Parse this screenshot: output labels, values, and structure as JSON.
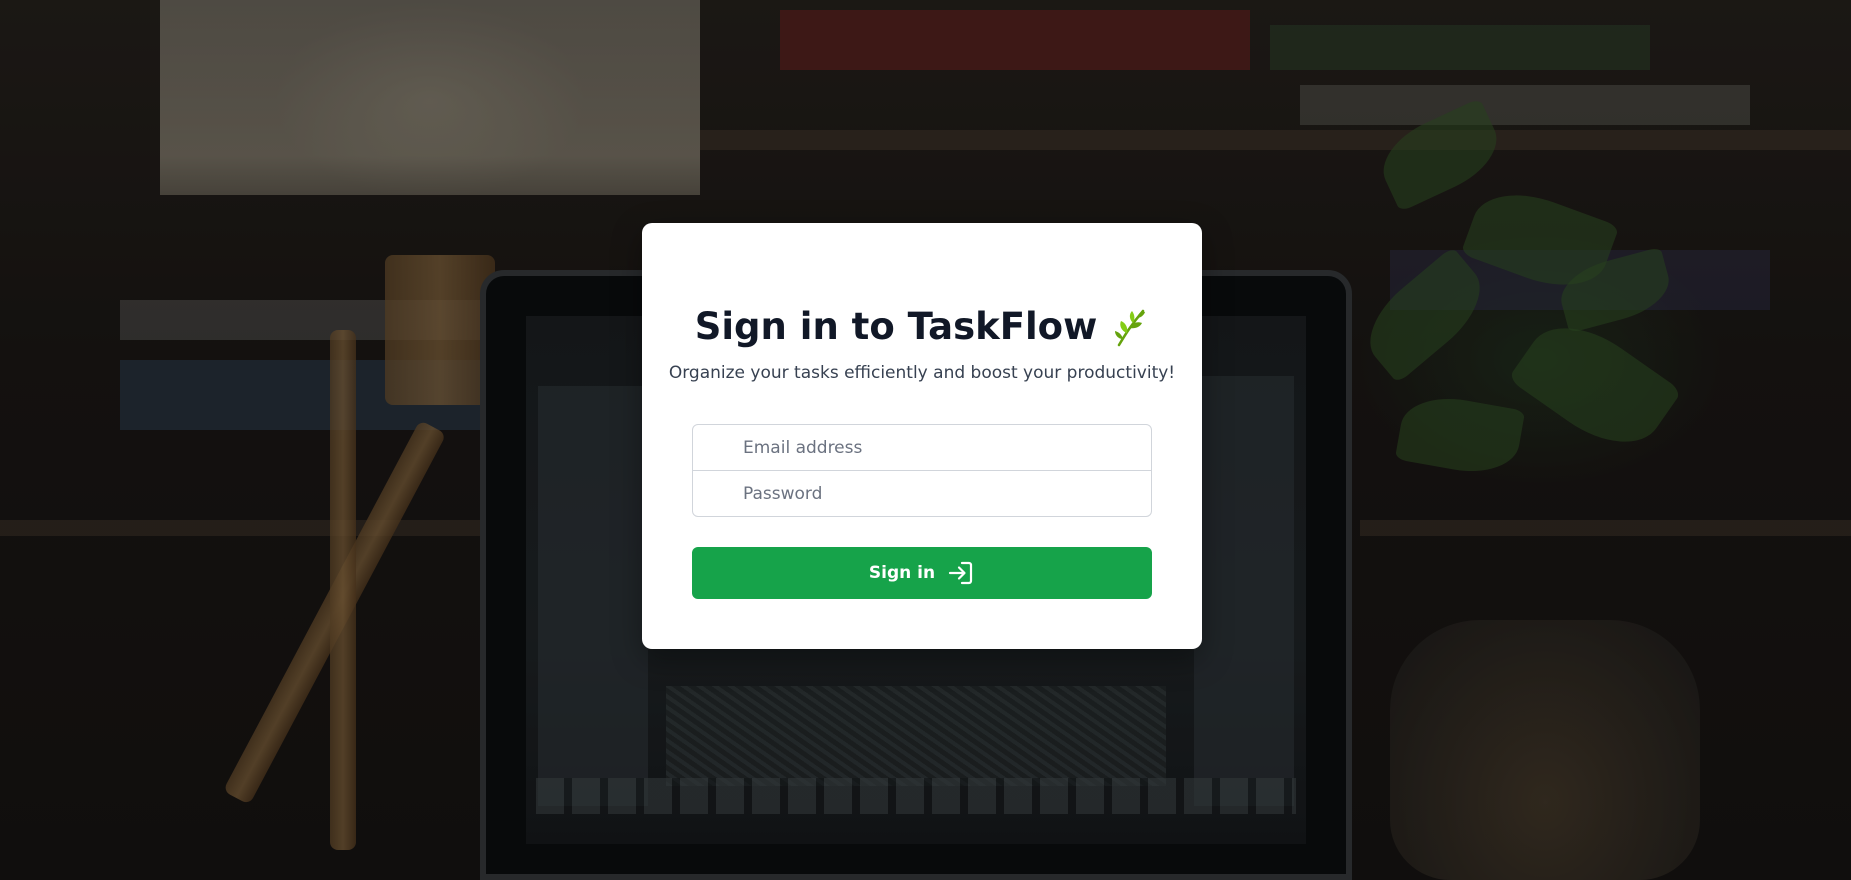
{
  "background": {
    "description_icon": "desk-workspace-photo",
    "laptop_app_icon": "photo-editor-screen"
  },
  "login": {
    "title": "Sign in to TaskFlow",
    "title_icon": "leaf-icon",
    "subtitle": "Organize your tasks efficiently and boost your productivity!",
    "email_placeholder": "Email address",
    "email_value": "",
    "password_placeholder": "Password",
    "password_value": "",
    "submit_label": "Sign in",
    "submit_icon": "sign-in-arrow-icon"
  },
  "colors": {
    "accent": "#16a34a",
    "title": "#111827",
    "subtitle": "#374151",
    "leaf": "#65a30d",
    "card": "#ffffff"
  }
}
